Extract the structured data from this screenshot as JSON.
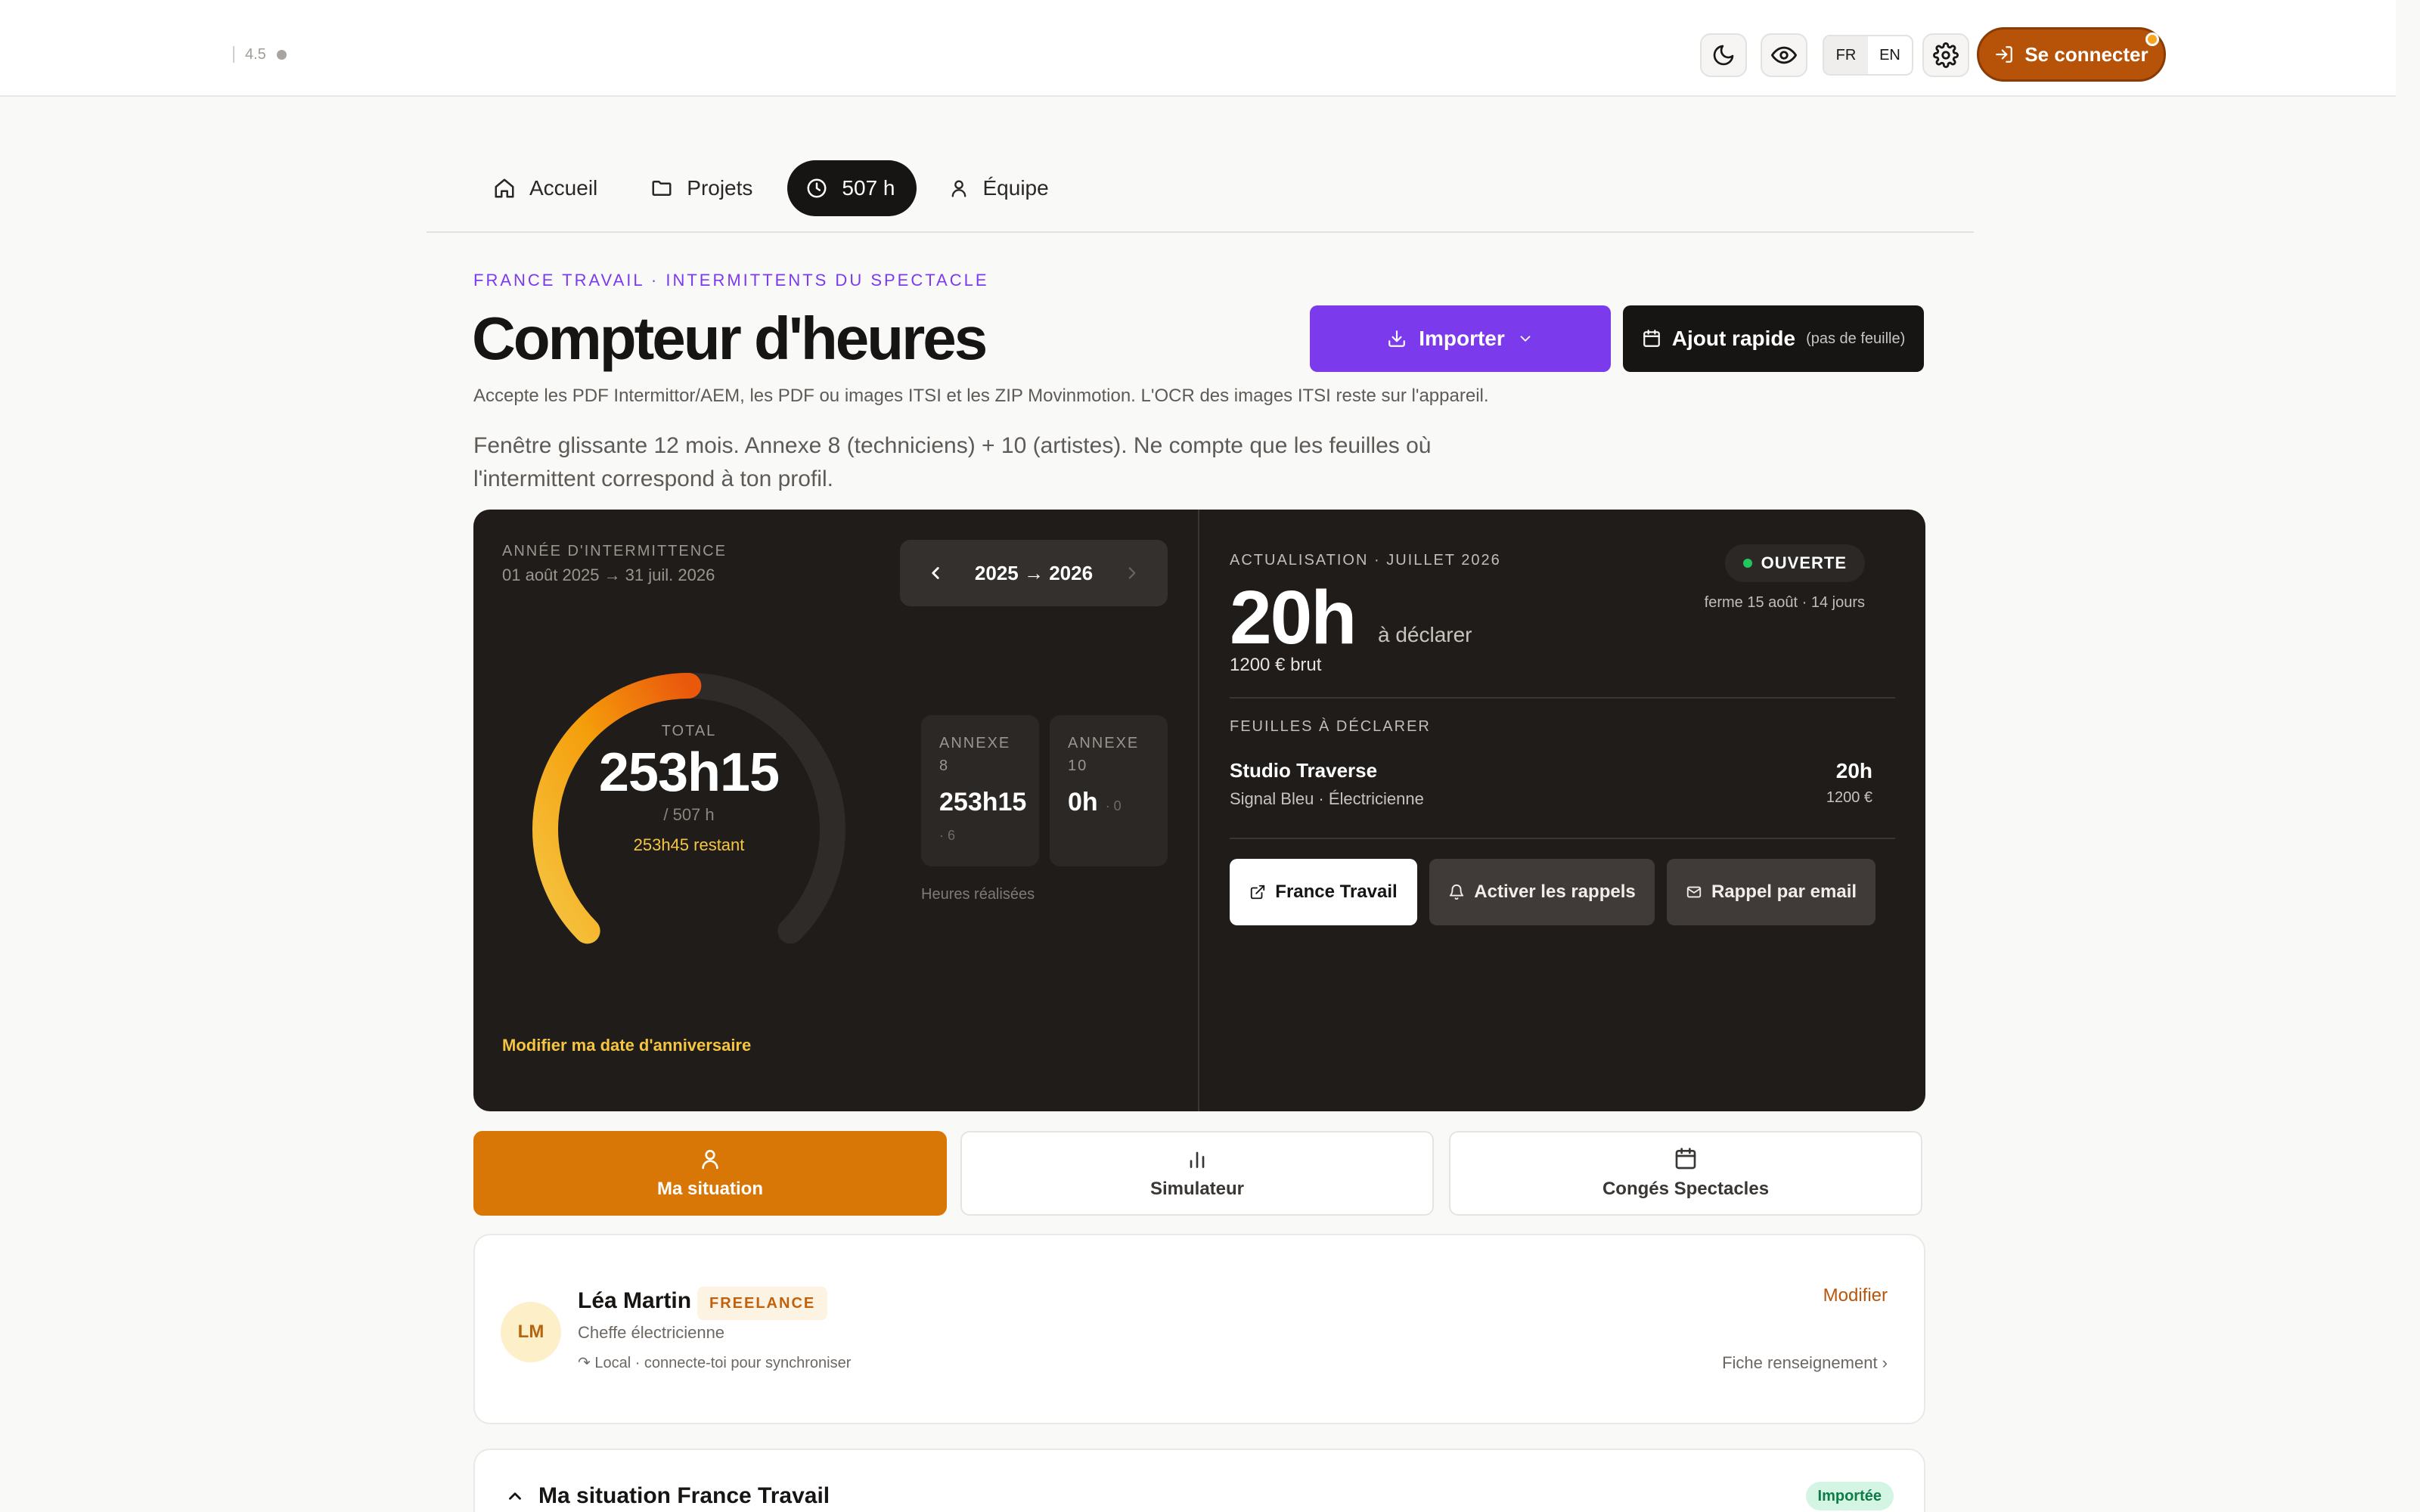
{
  "topbar": {
    "version": "4.5",
    "lang_fr": "FR",
    "lang_en": "EN",
    "lang_active": "FR",
    "connect_label": "Se connecter"
  },
  "nav": {
    "items": [
      {
        "label": "Accueil",
        "icon": "home-icon"
      },
      {
        "label": "Projets",
        "icon": "folder-icon"
      },
      {
        "label": "507 h",
        "icon": "clock-icon",
        "active": true
      },
      {
        "label": "Équipe",
        "icon": "user-icon"
      }
    ]
  },
  "header": {
    "eyebrow": "FRANCE TRAVAIL · INTERMITTENTS DU SPECTACLE",
    "title": "Compteur d'heures",
    "subtitle": "Accepte les PDF Intermittor/AEM, les PDF ou images ITSI et les ZIP Movinmotion. L'OCR des images ITSI reste sur l'appareil.",
    "description": "Fenêtre glissante 12 mois. Annexe 8 (techniciens) + 10 (artistes). Ne compte que les feuilles où l'intermittent correspond à ton profil.",
    "import_label": "Importer",
    "quick_label": "Ajout rapide",
    "quick_note": "(pas de feuille)"
  },
  "counter": {
    "year_label": "ANNÉE D'INTERMITTENCE",
    "year_range": "01 août 2025 → 31 juil. 2026",
    "year_selector": "2025 → 2026",
    "total_label": "TOTAL",
    "total_value": "253h15",
    "total_target": "/ 507 h",
    "remaining": "253h45 restant",
    "progress": 0.4993,
    "annexe8_label": "ANNEXE 8",
    "annexe8_value": "253h15",
    "annexe8_count": "· 6",
    "annexe10_label": "ANNEXE 10",
    "annexe10_value": "0h",
    "annexe10_count": "· 0",
    "realized_label": "Heures réalisées",
    "modify_date": "Modifier ma date d'anniversaire",
    "accent_colors": [
      "#f5c542",
      "#f59e0b",
      "#ea580c"
    ]
  },
  "actualisation": {
    "label": "ACTUALISATION · JUILLET 2026",
    "status": "OUVERTE",
    "closes": "ferme 15 août · 14 jours",
    "hours": "20h",
    "hours_suffix": "à déclarer",
    "gross": "1200 € brut",
    "sheets_label": "FEUILLES À DÉCLARER",
    "sheet": {
      "name": "Studio Traverse",
      "detail": "Signal Bleu · Électricienne",
      "hours": "20h",
      "amount": "1200 €"
    },
    "btn_france_travail": "France Travail",
    "btn_reminders": "Activer les rappels",
    "btn_email": "Rappel par email"
  },
  "tabs": [
    {
      "label": "Ma situation",
      "icon": "user-icon",
      "active": true
    },
    {
      "label": "Simulateur",
      "icon": "bar-chart-icon"
    },
    {
      "label": "Congés Spectacles",
      "icon": "calendar-icon"
    }
  ],
  "profile": {
    "initials": "LM",
    "name": "Léa Martin",
    "badge": "FREELANCE",
    "role": "Cheffe électricienne",
    "sync": "Local · connecte-toi pour synchroniser",
    "modify": "Modifier",
    "fiche": "Fiche renseignement ›"
  },
  "situation": {
    "title": "Ma situation France Travail",
    "badge": "Importée"
  }
}
